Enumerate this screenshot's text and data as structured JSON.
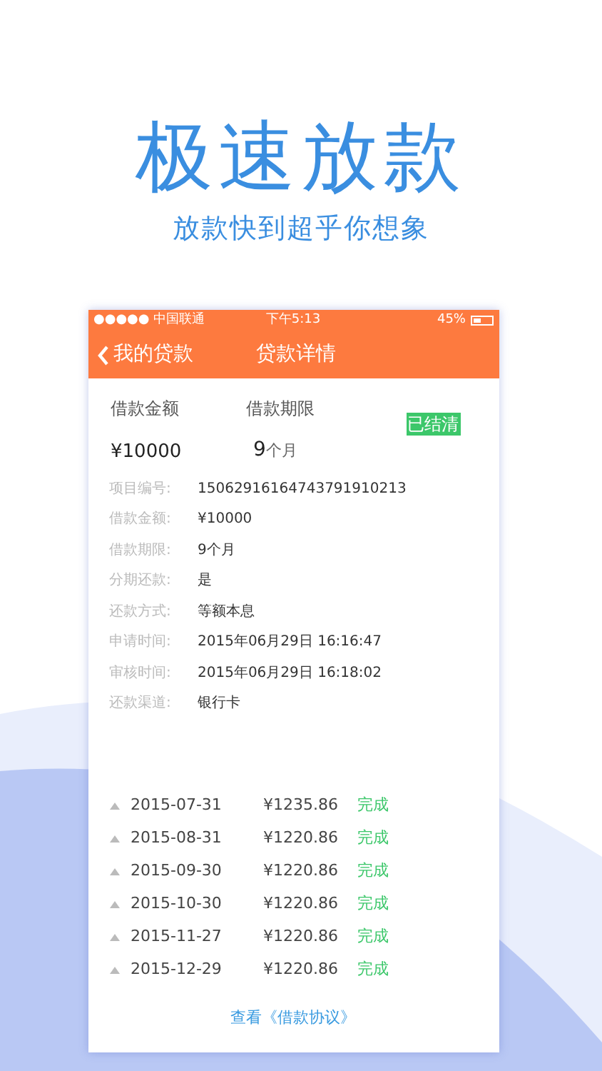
{
  "headline": "极速放款",
  "subheadline": "放款快到超乎你想象",
  "status_bar": {
    "carrier": "●●●●● 中国联通",
    "time": "下午5:13",
    "battery": "45%"
  },
  "nav": {
    "back": "我的贷款",
    "title": "贷款详情"
  },
  "summary": {
    "amount_label": "借款金额",
    "amount": "¥10000",
    "term_label": "借款期限",
    "term_number": "9",
    "term_unit": "个月",
    "badge": "已结清"
  },
  "details": [
    {
      "label": "项目编号:",
      "value": "15062916164743791910213"
    },
    {
      "label": "借款金额:",
      "value": "¥10000"
    },
    {
      "label": "借款期限:",
      "value": "9个月"
    },
    {
      "label": "分期还款:",
      "value": "是"
    },
    {
      "label": "还款方式:",
      "value": "等额本息"
    },
    {
      "label": "申请时间:",
      "value": "2015年06月29日 16:16:47"
    },
    {
      "label": "审核时间:",
      "value": "2015年06月29日 16:18:02"
    },
    {
      "label": "还款渠道:",
      "value": "银行卡"
    }
  ],
  "installments": [
    {
      "date": "2015-07-31",
      "amount": "¥1235.86",
      "status": "完成"
    },
    {
      "date": "2015-08-31",
      "amount": "¥1220.86",
      "status": "完成"
    },
    {
      "date": "2015-09-30",
      "amount": "¥1220.86",
      "status": "完成"
    },
    {
      "date": "2015-10-30",
      "amount": "¥1220.86",
      "status": "完成"
    },
    {
      "date": "2015-11-27",
      "amount": "¥1220.86",
      "status": "完成"
    },
    {
      "date": "2015-12-29",
      "amount": "¥1220.86",
      "status": "完成"
    }
  ],
  "agreement_link": "查看《借款协议》"
}
